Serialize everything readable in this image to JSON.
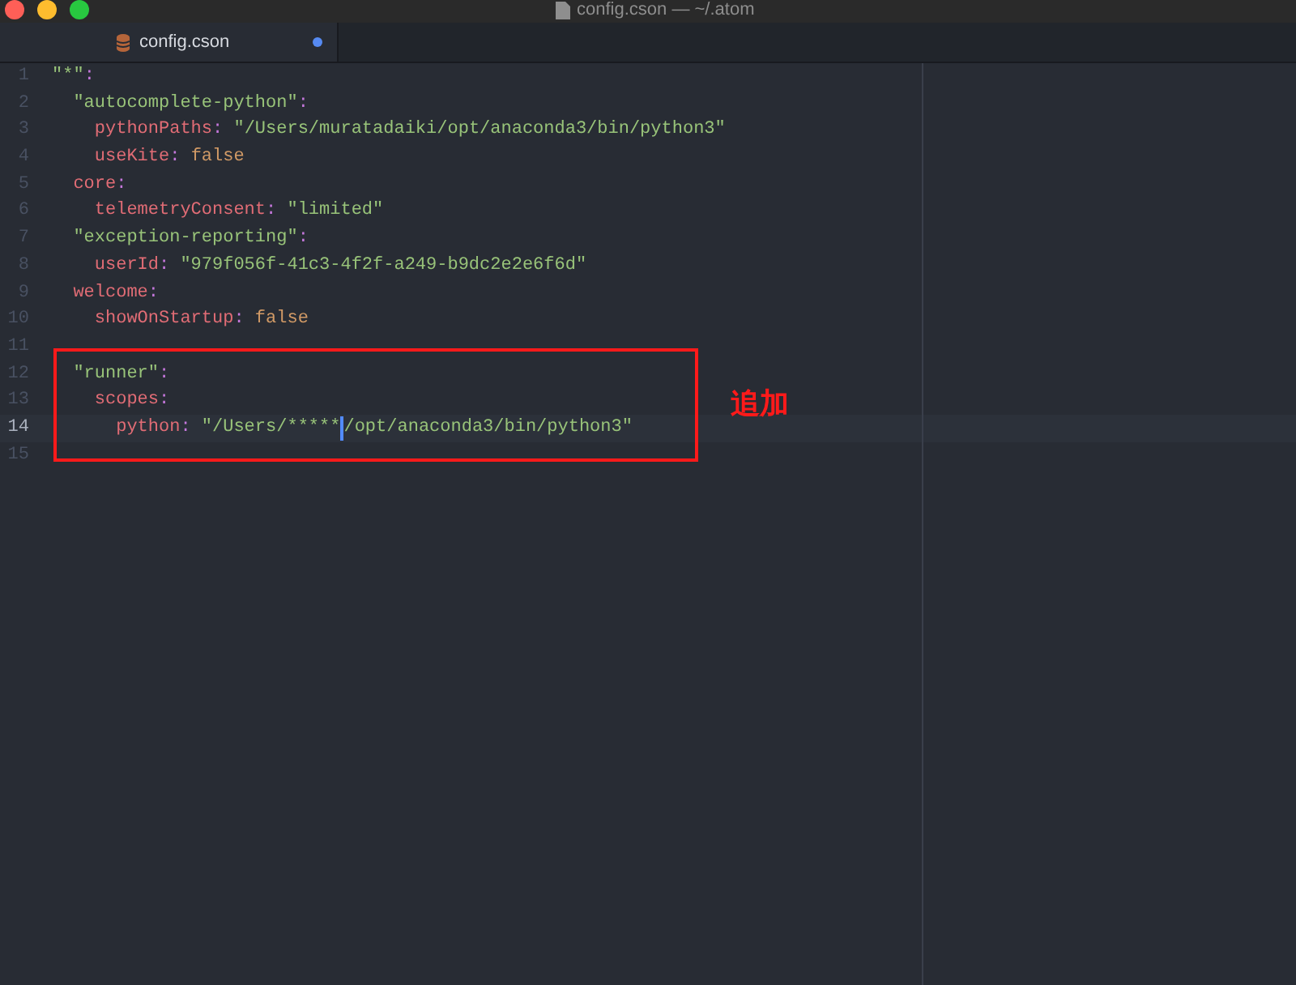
{
  "window": {
    "title": "config.cson — ~/.atom"
  },
  "tabs": [
    {
      "label": "config.cson",
      "selected": true,
      "modified": true
    }
  ],
  "editor": {
    "lines": [
      {
        "number": "1",
        "current": false,
        "tokens": [
          {
            "kind": "string",
            "text": "\"*\""
          },
          {
            "kind": "punct",
            "text": ":"
          }
        ],
        "children": [
          {
            "number": "2",
            "current": false,
            "tokens": [
              {
                "kind": "string",
                "text": "\"autocomplete-python\""
              },
              {
                "kind": "punct",
                "text": ":"
              }
            ],
            "children": [
              {
                "number": "3",
                "current": false,
                "tokens": [
                  {
                    "kind": "key",
                    "text": "pythonPaths"
                  },
                  {
                    "kind": "punct",
                    "text": ":"
                  },
                  {
                    "kind": "string",
                    "text": "\"/Users/muratadaiki/opt/anaconda3/bin/python3\""
                  }
                ]
              },
              {
                "number": "4",
                "current": false,
                "tokens": [
                  {
                    "kind": "key",
                    "text": "useKite"
                  },
                  {
                    "kind": "punct",
                    "text": ":"
                  },
                  {
                    "kind": "constant",
                    "text": "false"
                  }
                ]
              }
            ]
          },
          {
            "number": "5",
            "current": false,
            "tokens": [
              {
                "kind": "key",
                "text": "core"
              },
              {
                "kind": "punct",
                "text": ":"
              }
            ],
            "children": [
              {
                "number": "6",
                "current": false,
                "tokens": [
                  {
                    "kind": "key",
                    "text": "telemetryConsent"
                  },
                  {
                    "kind": "punct",
                    "text": ":"
                  },
                  {
                    "kind": "string",
                    "text": "\"limited\""
                  }
                ]
              }
            ]
          },
          {
            "number": "7",
            "current": false,
            "tokens": [
              {
                "kind": "string",
                "text": "\"exception-reporting\""
              },
              {
                "kind": "punct",
                "text": ":"
              }
            ],
            "children": [
              {
                "number": "8",
                "current": false,
                "tokens": [
                  {
                    "kind": "key",
                    "text": "userId"
                  },
                  {
                    "kind": "punct",
                    "text": ":"
                  },
                  {
                    "kind": "string",
                    "text": "\"979f056f-41c3-4f2f-a249-b9dc2e2e6f6d\""
                  }
                ]
              }
            ]
          },
          {
            "number": "9",
            "current": false,
            "tokens": [
              {
                "kind": "key",
                "text": "welcome"
              },
              {
                "kind": "punct",
                "text": ":"
              }
            ],
            "children": [
              {
                "number": "10",
                "current": false,
                "tokens": [
                  {
                    "kind": "key",
                    "text": "showOnStartup"
                  },
                  {
                    "kind": "punct",
                    "text": ":"
                  },
                  {
                    "kind": "constant",
                    "text": "false"
                  }
                ]
              }
            ]
          },
          {
            "number": "11",
            "current": false
          },
          {
            "number": "12",
            "current": false,
            "tokens": [
              {
                "kind": "string",
                "text": "\"runner\""
              },
              {
                "kind": "punct",
                "text": ":"
              }
            ],
            "children": [
              {
                "number": "13",
                "current": false,
                "tokens": [
                  {
                    "kind": "key",
                    "text": "scopes"
                  },
                  {
                    "kind": "punct",
                    "text": ":"
                  }
                ],
                "children": [
                  {
                    "number": "14",
                    "current": true,
                    "tokens": [
                      {
                        "kind": "key",
                        "text": "python"
                      },
                      {
                        "kind": "punct",
                        "text": ":"
                      },
                      {
                        "kind": "string",
                        "text": "\"/Users/*****",
                        "cursor_after": true
                      },
                      {
                        "kind": "string",
                        "text": "/opt/anaconda3/bin/python3\""
                      }
                    ]
                  }
                ]
              }
            ]
          }
        ]
      },
      {
        "number": "15",
        "current": false
      }
    ]
  },
  "annotation": {
    "label": "追加"
  }
}
